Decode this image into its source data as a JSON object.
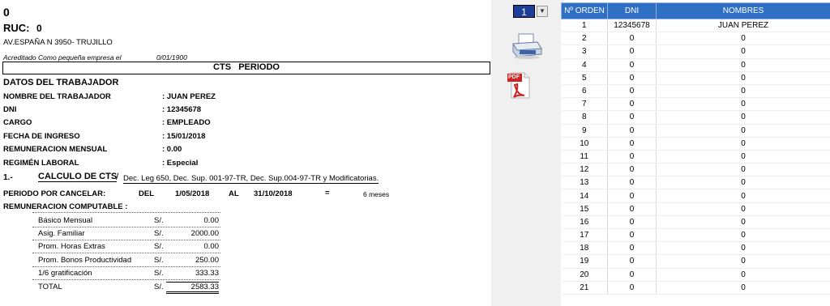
{
  "header": {
    "company": "0",
    "ruc_label": "RUC:",
    "ruc_value": "0",
    "address": "AV.ESPAÑA N 3950- TRUJILLO",
    "accredited": "Acreditado Como pequeña empresa el",
    "accredited_date": "0/01/1900"
  },
  "doc_title": "CTS   PERIODO",
  "worker": {
    "section_title": "DATOS DEL TRABAJADOR",
    "fields": [
      {
        "label": "NOMBRE DEL TRABAJADOR",
        "value": ": JUAN PEREZ"
      },
      {
        "label": "DNI",
        "value": ": 12345678"
      },
      {
        "label": "CARGO",
        "value": ": EMPLEADO"
      },
      {
        "label": "FECHA DE INGRESO",
        "value": ": 15/01/2018"
      },
      {
        "label": "REMUNERACION MENSUAL",
        "value": ": 0.00"
      },
      {
        "label": "REGIMÉN LABORAL",
        "value": ": Especial"
      }
    ]
  },
  "calc": {
    "number": "1.-",
    "title": "CALCULO DE CTS",
    "slash": "/",
    "legal": "Dec. Leg 650, Dec. Sup. 001-97-TR, Dec. Sup.004-97-TR y Modificatorias.",
    "period_label": "PERIODO POR CANCELAR:",
    "del_label": "DEL",
    "date_from": "1/05/2018",
    "al_label": "AL",
    "date_to": "31/10/2018",
    "equals": "=",
    "months": "6 meses",
    "rem_label": "REMUNERACION COMPUTABLE :",
    "items": [
      {
        "name": "Básico Mensual",
        "cur": "S/.",
        "amount": "0.00"
      },
      {
        "name": "Asig. Familiar",
        "cur": "S/.",
        "amount": "2000.00"
      },
      {
        "name": "Prom. Horas Extras",
        "cur": "S/.",
        "amount": "0.00"
      },
      {
        "name": "Prom. Bonos Productividad",
        "cur": "S/.",
        "amount": "250.00"
      },
      {
        "name": "1/6 gratificación",
        "cur": "S/.",
        "amount": "333.33"
      }
    ],
    "total_label": "TOTAL",
    "total_cur": "S/.",
    "total_amount": "2583.33"
  },
  "selector": {
    "value": "1"
  },
  "icons": {
    "printer": "printer-icon",
    "pdf": "pdf-icon",
    "pdf_text": "PDF"
  },
  "grid": {
    "headers": [
      "Nº ORDEN",
      "DNI",
      "NOMBRES"
    ],
    "rows": [
      [
        "1",
        "12345678",
        "JUAN PEREZ"
      ],
      [
        "2",
        "0",
        "0"
      ],
      [
        "3",
        "0",
        "0"
      ],
      [
        "4",
        "0",
        "0"
      ],
      [
        "5",
        "0",
        "0"
      ],
      [
        "6",
        "0",
        "0"
      ],
      [
        "7",
        "0",
        "0"
      ],
      [
        "8",
        "0",
        "0"
      ],
      [
        "9",
        "0",
        "0"
      ],
      [
        "10",
        "0",
        "0"
      ],
      [
        "11",
        "0",
        "0"
      ],
      [
        "12",
        "0",
        "0"
      ],
      [
        "13",
        "0",
        "0"
      ],
      [
        "14",
        "0",
        "0"
      ],
      [
        "15",
        "0",
        "0"
      ],
      [
        "16",
        "0",
        "0"
      ],
      [
        "17",
        "0",
        "0"
      ],
      [
        "18",
        "0",
        "0"
      ],
      [
        "19",
        "0",
        "0"
      ],
      [
        "20",
        "0",
        "0"
      ],
      [
        "21",
        "0",
        "0"
      ]
    ]
  }
}
